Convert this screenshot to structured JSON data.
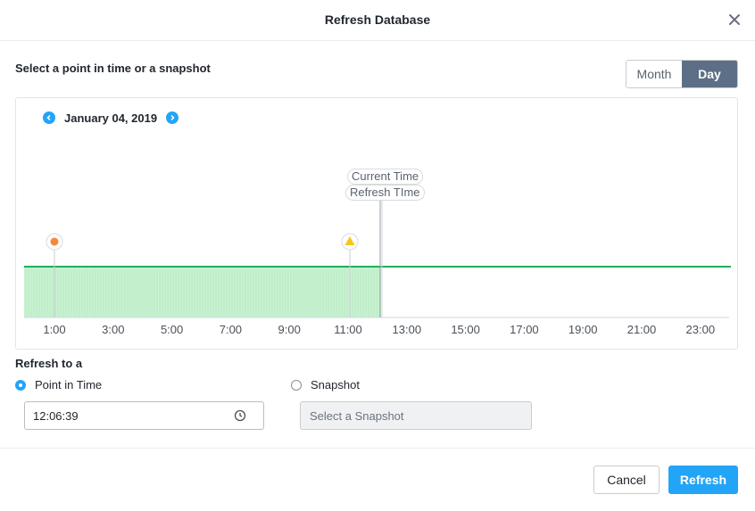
{
  "dialog": {
    "title": "Refresh Database"
  },
  "picker": {
    "label": "Select a point in time or a snapshot",
    "view_toggle": {
      "month_label": "Month",
      "day_label": "Day",
      "selected": "Day"
    }
  },
  "timeline": {
    "date": "January 04, 2019",
    "hour_labels": [
      "1:00",
      "3:00",
      "5:00",
      "7:00",
      "9:00",
      "11:00",
      "13:00",
      "15:00",
      "17:00",
      "19:00",
      "21:00",
      "23:00"
    ],
    "current_time_label": "Current Time",
    "refresh_time_label": "Refresh TIme",
    "colors": {
      "available_fill": "#c9f2d2",
      "available_line": "#1fae5b",
      "event_orange": "#f5893a",
      "event_yellow": "#f7c614"
    }
  },
  "refresh_to": {
    "label": "Refresh to a",
    "point_in_time_label": "Point in Time",
    "snapshot_label": "Snapshot",
    "selected": "Point in Time",
    "time_value": "12:06:39",
    "snapshot_placeholder": "Select a Snapshot"
  },
  "footer": {
    "cancel_label": "Cancel",
    "refresh_label": "Refresh"
  }
}
